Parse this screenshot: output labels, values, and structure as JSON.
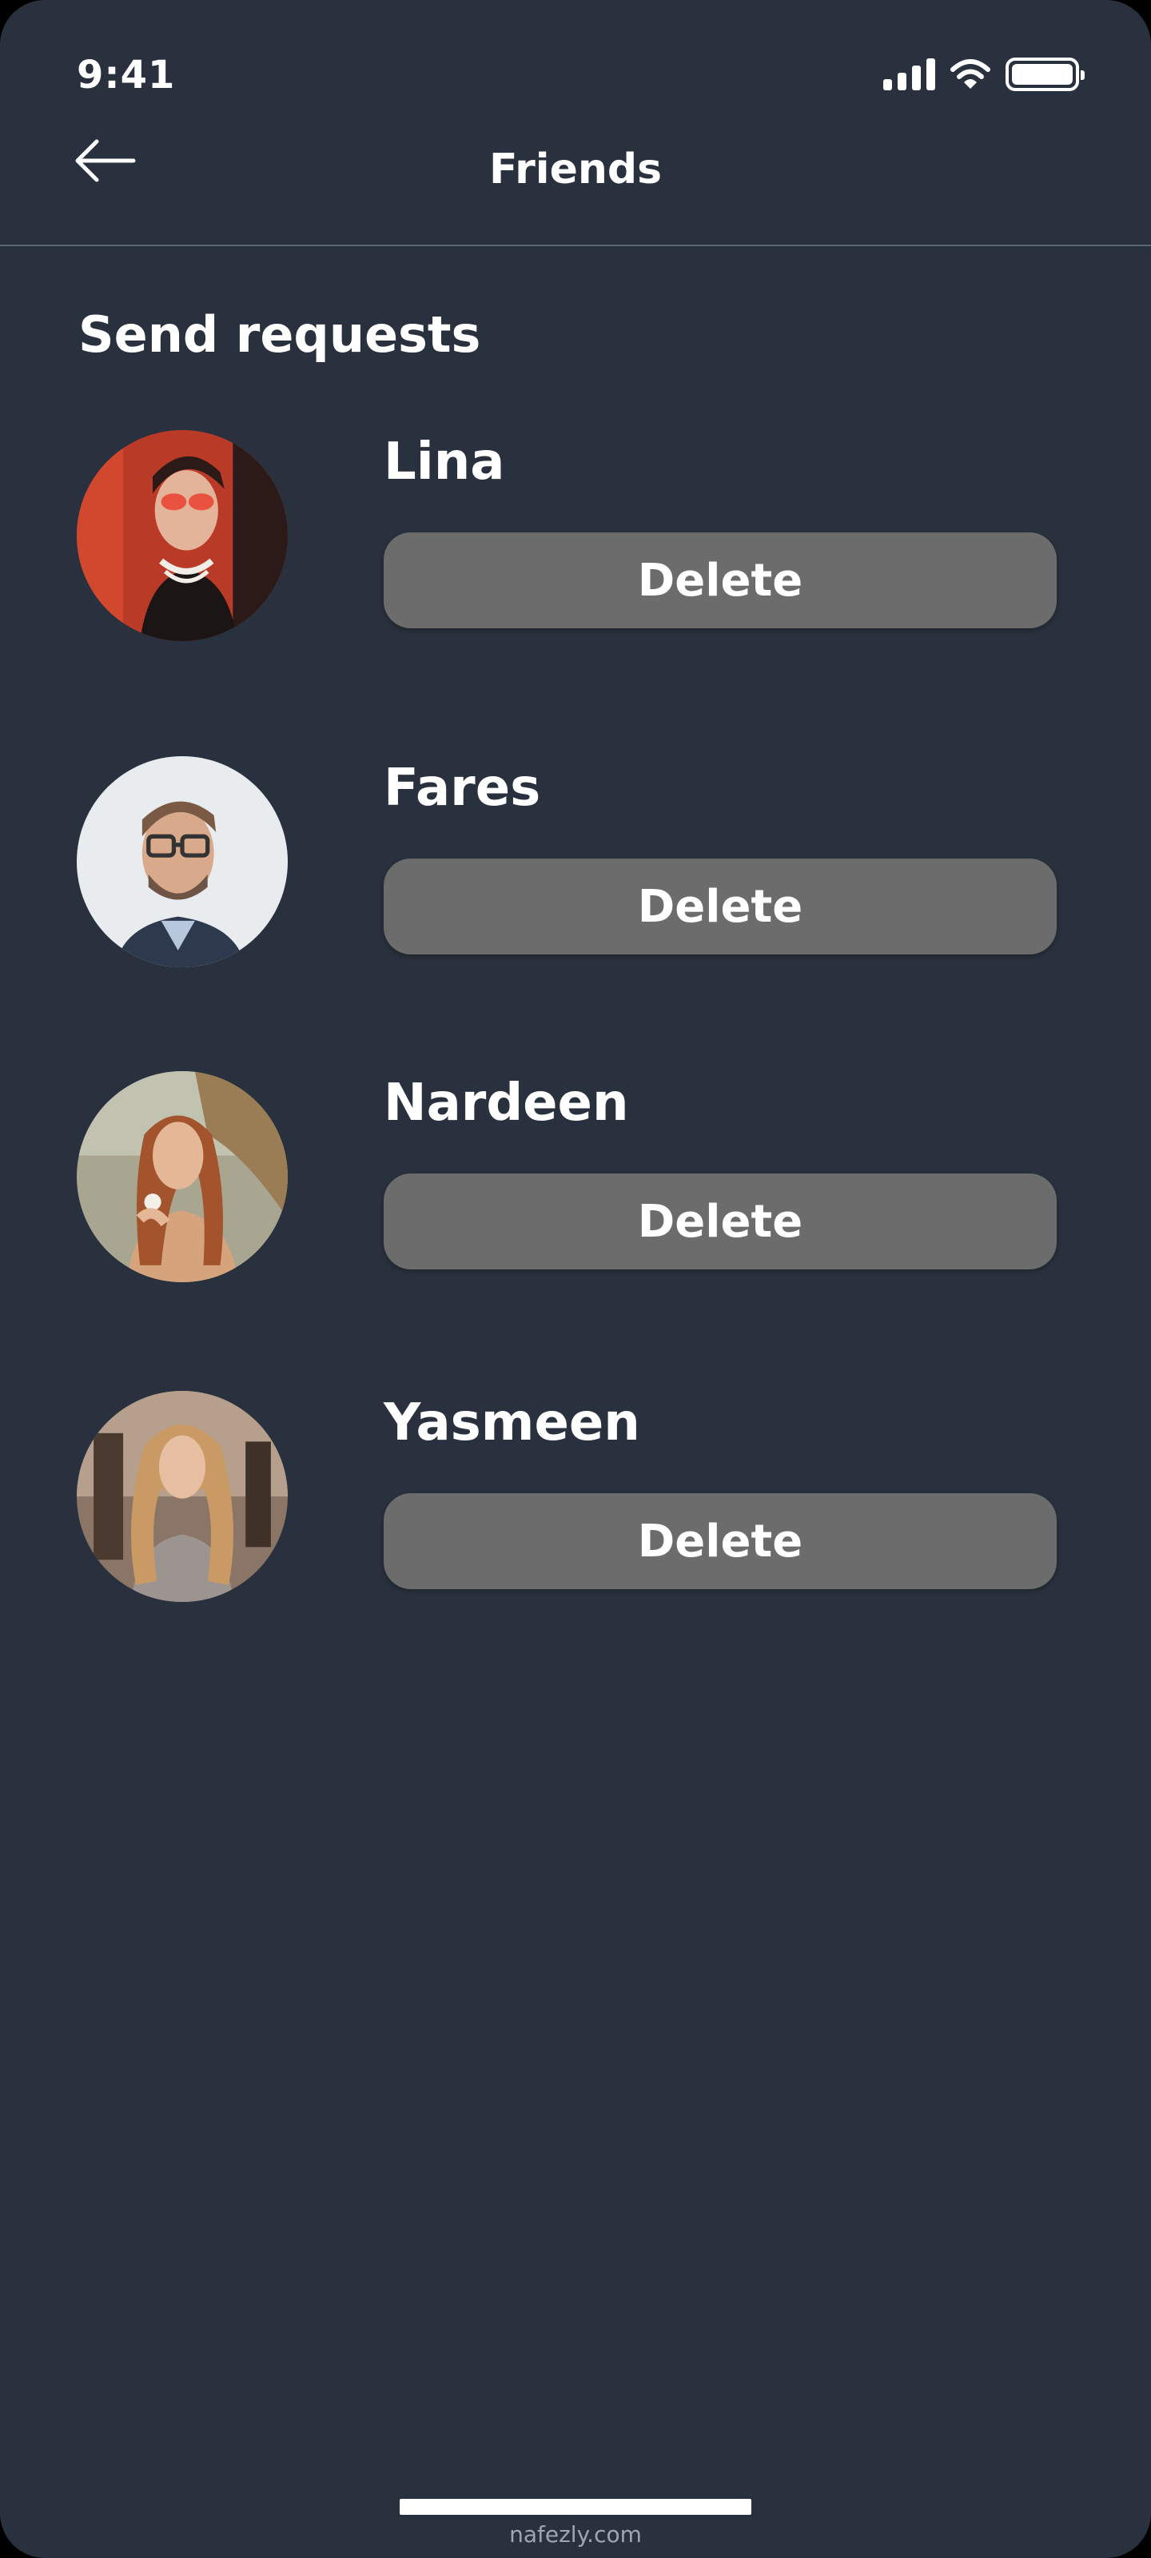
{
  "status_bar": {
    "time": "9:41",
    "icons": [
      "cellular-signal-icon",
      "wifi-icon",
      "battery-icon"
    ]
  },
  "header": {
    "title": "Friends",
    "back_icon": "arrow-left-icon"
  },
  "section": {
    "title": "Send requests"
  },
  "requests": [
    {
      "name": "Lina",
      "delete_label": "Delete",
      "avatar": "photo of woman in red sunglasses and pearl necklace"
    },
    {
      "name": "Fares",
      "delete_label": "Delete",
      "avatar": "photo of man with glasses and beard"
    },
    {
      "name": "Nardeen",
      "delete_label": "Delete",
      "avatar": "photo of woman with long auburn hair and sun hat"
    },
    {
      "name": "Yasmeen",
      "delete_label": "Delete",
      "avatar": "photo of woman with long wavy blonde hair"
    }
  ],
  "watermark": "nafezly.com",
  "colors": {
    "background": "#28313d",
    "button": "#6c6c6c",
    "text": "#ffffff",
    "divider": "#5d6773"
  }
}
